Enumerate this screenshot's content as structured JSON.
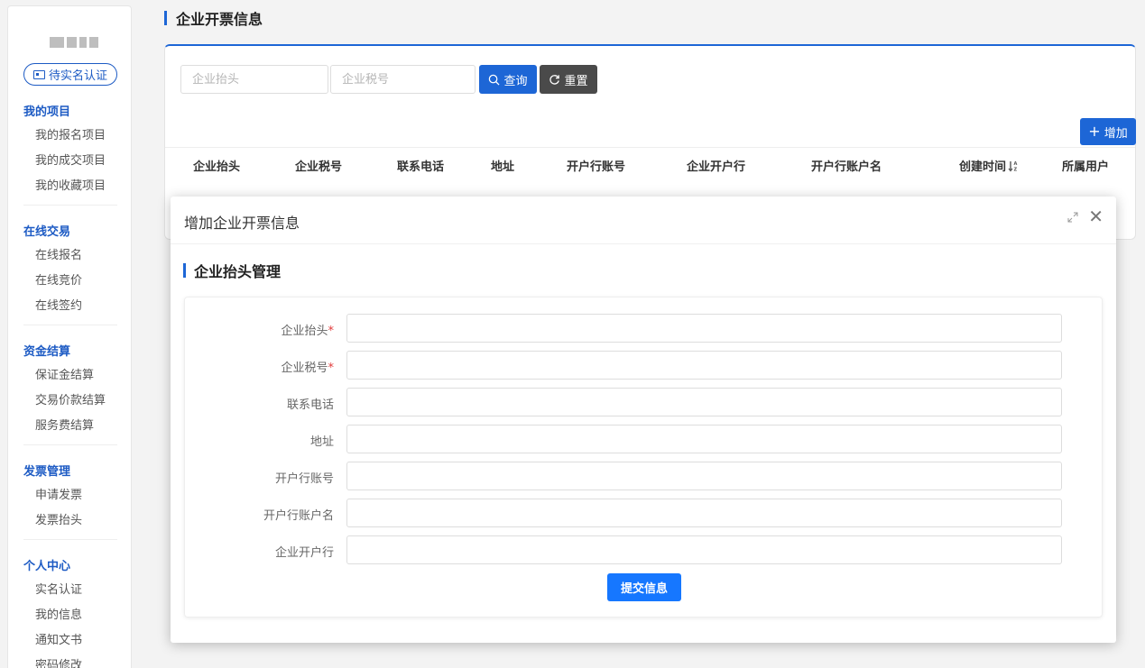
{
  "sidebar": {
    "verify_badge": "待实名认证",
    "groups": [
      {
        "title": "我的项目",
        "items": [
          "我的报名项目",
          "我的成交项目",
          "我的收藏项目"
        ]
      },
      {
        "title": "在线交易",
        "items": [
          "在线报名",
          "在线竞价",
          "在线签约"
        ]
      },
      {
        "title": "资金结算",
        "items": [
          "保证金结算",
          "交易价款结算",
          "服务费结算"
        ]
      },
      {
        "title": "发票管理",
        "items": [
          "申请发票",
          "发票抬头"
        ]
      },
      {
        "title": "个人中心",
        "items": [
          "实名认证",
          "我的信息",
          "通知文书",
          "密码修改"
        ]
      }
    ]
  },
  "page": {
    "title": "企业开票信息",
    "search": {
      "title_placeholder": "企业抬头",
      "tax_placeholder": "企业税号",
      "query_label": "查询",
      "reset_label": "重置",
      "add_label": "增加"
    },
    "table_headers": [
      "企业抬头",
      "企业税号",
      "联系电话",
      "地址",
      "开户行账号",
      "企业开户行",
      "开户行账户名",
      "创建时间",
      "所属用户"
    ]
  },
  "modal": {
    "title": "增加企业开票信息",
    "section_title": "企业抬头管理",
    "fields": [
      {
        "label": "企业抬头",
        "required": "*",
        "value": ""
      },
      {
        "label": "企业税号",
        "required": "*",
        "value": ""
      },
      {
        "label": "联系电话",
        "required": "",
        "value": ""
      },
      {
        "label": "地址",
        "required": "",
        "value": ""
      },
      {
        "label": "开户行账号",
        "required": "",
        "value": ""
      },
      {
        "label": "开户行账户名",
        "required": "",
        "value": ""
      },
      {
        "label": "企业开户行",
        "required": "",
        "value": ""
      }
    ],
    "submit_label": "提交信息"
  },
  "colors": {
    "accent": "#1d66d6",
    "reset": "#4a4a4a",
    "required": "#e13b3b"
  }
}
